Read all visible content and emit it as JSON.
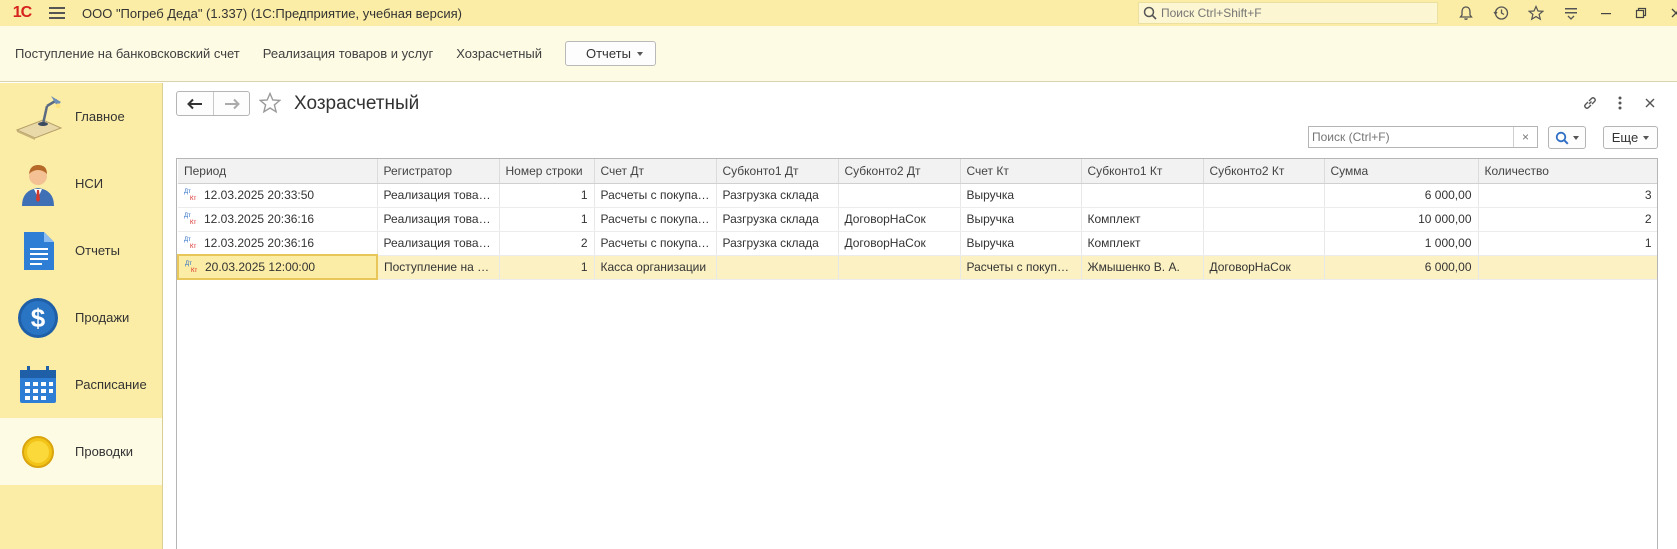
{
  "app": {
    "logo": "1С",
    "title": "ООО \"Погреб Деда\" (1.337)  (1С:Предприятие, учебная версия)",
    "search_placeholder": "Поиск Ctrl+Shift+F"
  },
  "sections": {
    "links": [
      "Поступление на банковсковский счет",
      "Реализация товаров и услуг",
      "Хозрасчетный"
    ],
    "reports_button": "Отчеты"
  },
  "sidebar": {
    "items": [
      {
        "label": "Главное",
        "icon": "desk-lamp-icon"
      },
      {
        "label": "НСИ",
        "icon": "person-icon"
      },
      {
        "label": "Отчеты",
        "icon": "document-icon"
      },
      {
        "label": "Продажи",
        "icon": "dollar-icon"
      },
      {
        "label": "Расписание",
        "icon": "calendar-icon"
      },
      {
        "label": "Проводки",
        "icon": "coin-icon"
      }
    ]
  },
  "form": {
    "title": "Хозрасчетный",
    "search_placeholder": "Поиск (Ctrl+F)",
    "search_clear": "×",
    "more_button": "Еще"
  },
  "table": {
    "columns": [
      "Период",
      "Регистратор",
      "Номер строки",
      "Счет Дт",
      "Субконто1 Дт",
      "Субконто2 Дт",
      "Счет Кт",
      "Субконто1 Кт",
      "Субконто2 Кт",
      "Сумма",
      "Количество"
    ],
    "rows": [
      [
        "12.03.2025 20:33:50",
        "Реализация товаров",
        "1",
        "Расчеты с покупателями",
        "Разгрузка склада",
        "",
        "Выручка",
        "",
        "",
        "6 000,00",
        "3"
      ],
      [
        "12.03.2025 20:36:16",
        "Реализация товаров",
        "1",
        "Расчеты с покупателями",
        "Разгрузка склада",
        "ДоговорНаСок",
        "Выручка",
        "Комплект",
        "",
        "10 000,00",
        "2"
      ],
      [
        "12.03.2025 20:36:16",
        "Реализация товаров",
        "2",
        "Расчеты с покупателями",
        "Разгрузка склада",
        "ДоговорНаСок",
        "Выручка",
        "Комплект",
        "",
        "1 000,00",
        "1"
      ],
      [
        "20.03.2025 12:00:00",
        "Поступление на банковский счет",
        "1",
        "Касса организации",
        "",
        "",
        "Расчеты с покупателями",
        "Жмышенко В. А.",
        "ДоговорНаСок",
        "6 000,00",
        ""
      ]
    ],
    "selected_row": 3
  },
  "colors": {
    "titlebar_bg": "#fbeda5",
    "section_bg": "#fefbe4",
    "selection": "#fbf1c3",
    "logo_red": "#d6231f"
  }
}
